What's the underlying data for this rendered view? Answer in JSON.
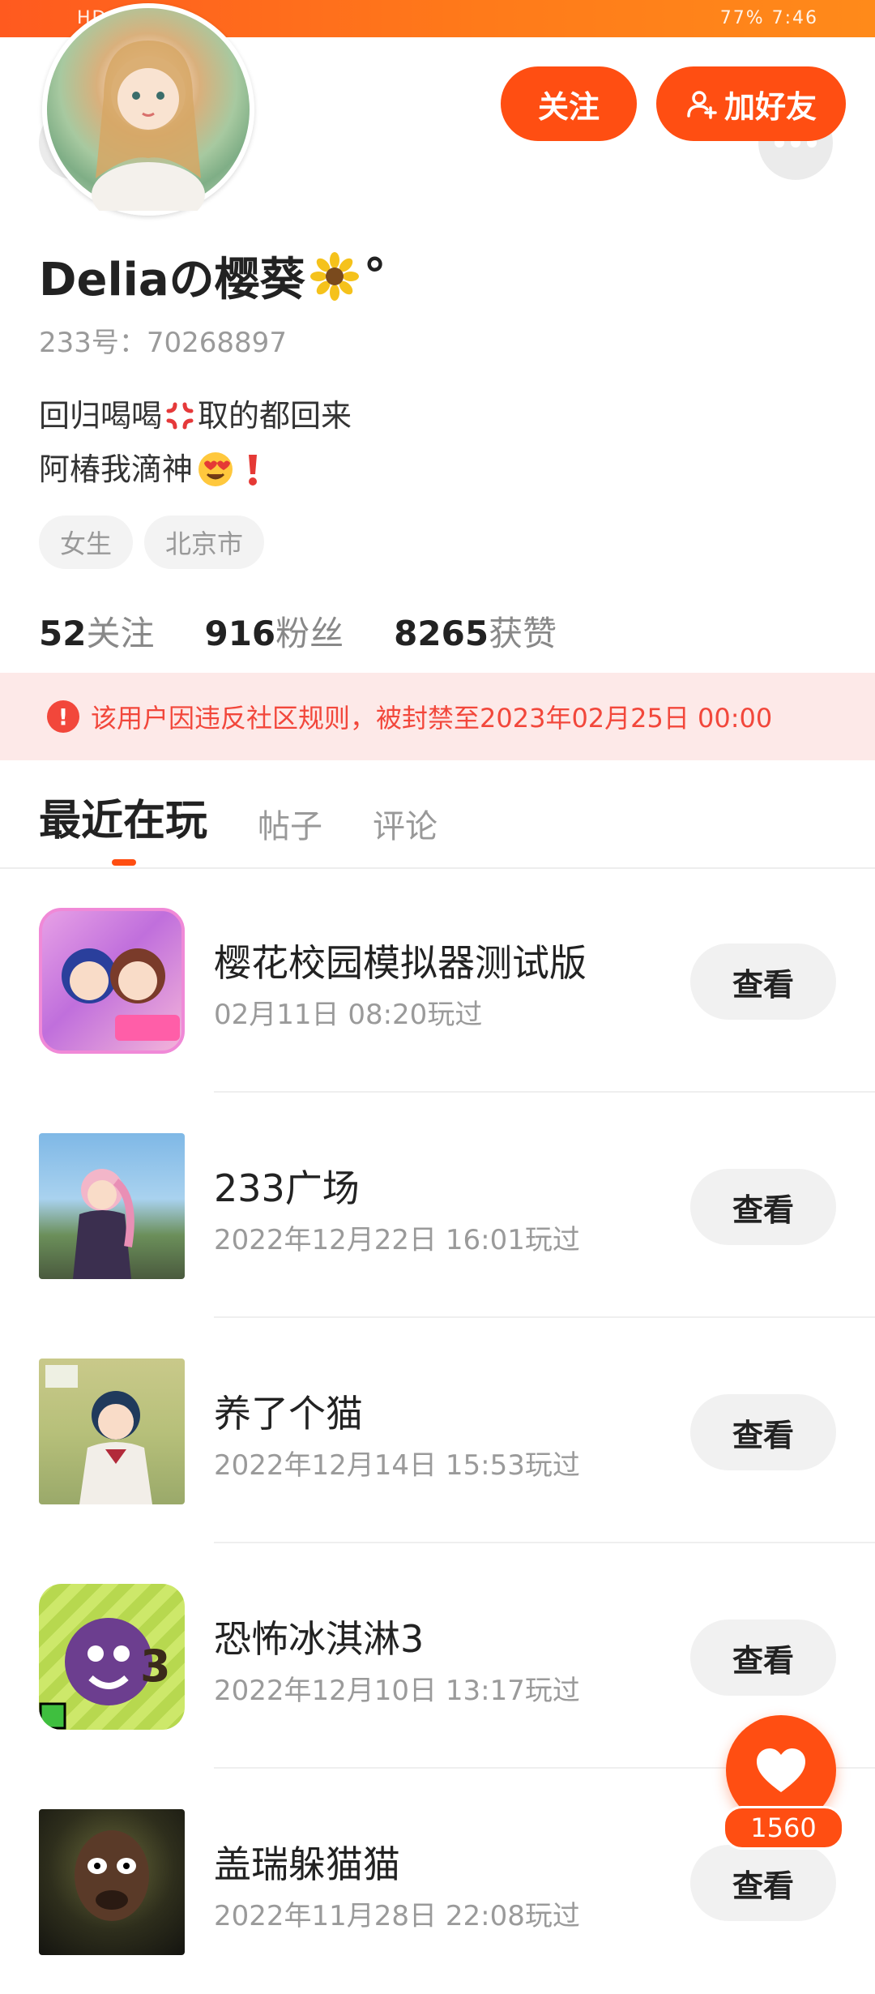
{
  "status_bar": {
    "left_text": "HD 2G",
    "right_text": "77%  7:46"
  },
  "header": {
    "follow_label": "关注",
    "add_friend_label": "加好友",
    "back_icon": "chevron-left-icon",
    "more_icon": "more-dots-icon"
  },
  "profile": {
    "nickname": "Deliaの樱葵",
    "nickname_suffix": "°",
    "uid": "233号：70268897",
    "bio_line1": "回归喝喝",
    "bio_line1_tail": "取的都回来",
    "bio_line2": "阿椿我滴神",
    "tags": [
      "女生",
      "北京市"
    ]
  },
  "stats": [
    {
      "value": "52",
      "label": "关注"
    },
    {
      "value": "916",
      "label": "粉丝"
    },
    {
      "value": "8265",
      "label": "获赞"
    }
  ],
  "ban_notice": "该用户因违反社区规则，被封禁至2023年02月25日 00:00",
  "tabs": [
    {
      "label": "最近在玩",
      "active": true
    },
    {
      "label": "帖子",
      "active": false
    },
    {
      "label": "评论",
      "active": false
    }
  ],
  "games": [
    {
      "name": "樱花校园模拟器测试版",
      "time": "02月11日 08:20玩过",
      "button": "查看"
    },
    {
      "name": "233广场",
      "time": "2022年12月22日 16:01玩过",
      "button": "查看"
    },
    {
      "name": "养了个猫",
      "time": "2022年12月14日 15:53玩过",
      "button": "查看"
    },
    {
      "name": "恐怖冰淇淋3",
      "time": "2022年12月10日 13:17玩过",
      "button": "查看"
    },
    {
      "name": "盖瑞躲猫猫",
      "time": "2022年11月28日 22:08玩过",
      "button": "查看"
    }
  ],
  "like_fab": {
    "count": "1560"
  },
  "colors": {
    "accent": "#ff4e12",
    "ban_text": "#f2473b",
    "ban_bg": "#fde9e8"
  }
}
